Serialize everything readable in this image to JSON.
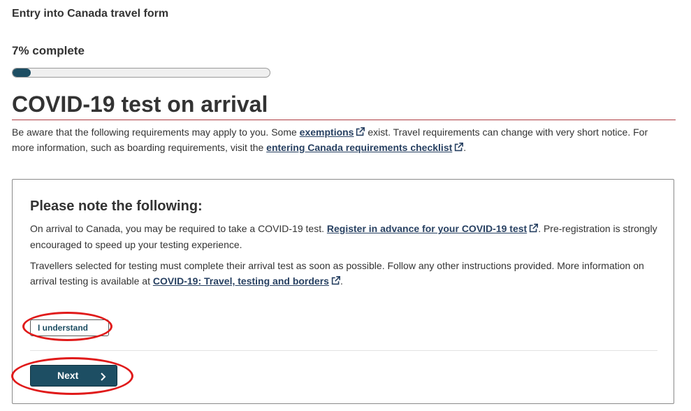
{
  "header": {
    "form_title": "Entry into Canada travel form"
  },
  "progress": {
    "label": "7% complete",
    "percent": 7
  },
  "page": {
    "title": "COVID-19 test on arrival",
    "intro": {
      "text1": "Be aware that the following requirements may apply to you. Some ",
      "link1": "exemptions",
      "text2": " exist. Travel requirements can change with very short notice. For more information, such as boarding requirements, visit the ",
      "link2": "entering Canada requirements checklist",
      "text3": "."
    }
  },
  "notice": {
    "heading": "Please note the following:",
    "p1": {
      "text1": "On arrival to Canada, you may be required to take a COVID-19 test. ",
      "link": "Register in advance for your COVID-19 test",
      "text2": ". Pre-registration is strongly encouraged to speed up your testing experience."
    },
    "p2": {
      "text1": "Travellers selected for testing must complete their arrival test as soon as possible. Follow any other instructions provided. More information on arrival testing is available at ",
      "link": "COVID-19: Travel, testing and borders",
      "text2": "."
    },
    "understand_button": "I understand",
    "next_button": "Next"
  },
  "icons": {
    "external_link": "external-link-icon",
    "next": "chevron-right-icon"
  },
  "colors": {
    "primary": "#1d4e63",
    "link": "#284162",
    "accent_rule": "#af3c43",
    "annotation": "#e01a1a"
  }
}
